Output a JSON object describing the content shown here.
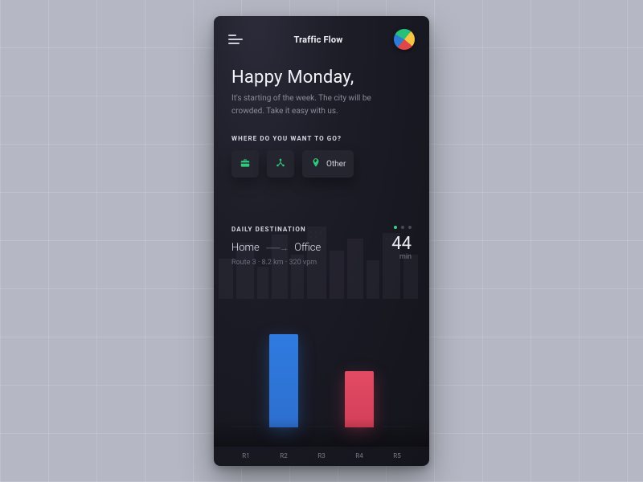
{
  "header": {
    "title": "Traffic Flow"
  },
  "greeting": {
    "headline": "Happy Monday,",
    "sub": "It's starting of the week. The city will be crowded. Take it easy with us."
  },
  "where": {
    "label": "WHERE DO YOU WANT TO GO?",
    "other_label": "Other"
  },
  "daily": {
    "label": "DAILY DESTINATION",
    "from": "Home",
    "to": "Office",
    "meta": "Route 3 · 8.2 km · 320 vpm",
    "eta_value": "44",
    "eta_unit": "min"
  },
  "chart_data": {
    "type": "bar",
    "categories": [
      "R1",
      "R2",
      "R3",
      "R4",
      "R5"
    ],
    "values": [
      0,
      100,
      0,
      60,
      0
    ],
    "series_colors": [
      "",
      "blue",
      "",
      "red",
      ""
    ],
    "title": "DAILY DESTINATION",
    "xlabel": "",
    "ylabel": "",
    "ylim": [
      0,
      100
    ]
  }
}
